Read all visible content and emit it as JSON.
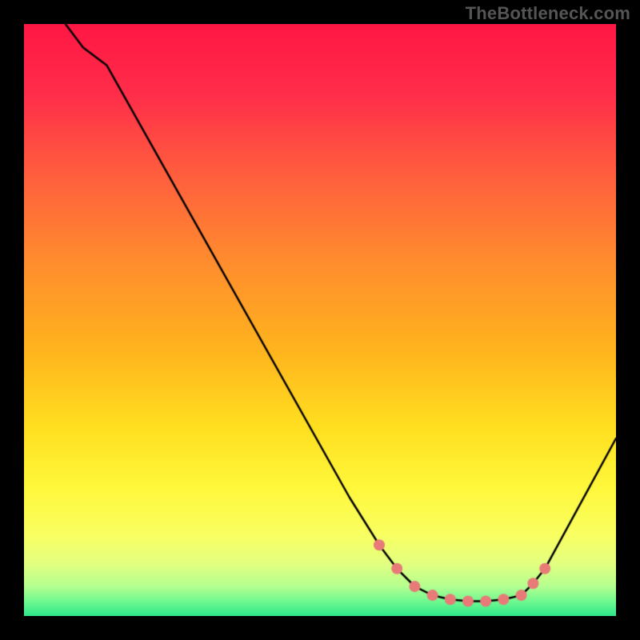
{
  "watermark": "TheBottleneck.com",
  "chart_data": {
    "type": "line",
    "title": "",
    "xlabel": "",
    "ylabel": "",
    "xlim": [
      0,
      100
    ],
    "ylim": [
      0,
      100
    ],
    "series": [
      {
        "name": "curve",
        "x": [
          7,
          10,
          14,
          55,
          60,
          63,
          66,
          69,
          72,
          75,
          78,
          81,
          84,
          86,
          88,
          100
        ],
        "y": [
          100,
          96,
          93,
          20,
          12,
          8,
          5,
          3.5,
          2.8,
          2.5,
          2.5,
          2.8,
          3.5,
          5.5,
          8,
          30
        ],
        "stroke": "#000000",
        "stroke_width": 2.5
      }
    ],
    "markers": {
      "name": "flat-points",
      "x": [
        60,
        63,
        66,
        69,
        72,
        75,
        78,
        81,
        84,
        86,
        88
      ],
      "y": [
        12,
        8,
        5,
        3.5,
        2.8,
        2.5,
        2.5,
        2.8,
        3.5,
        5.5,
        8
      ],
      "radius": 7,
      "fill": "#e87a78"
    },
    "background_gradient": {
      "stops": [
        {
          "offset": 0.0,
          "color": "#ff1744"
        },
        {
          "offset": 0.12,
          "color": "#ff2e4a"
        },
        {
          "offset": 0.25,
          "color": "#ff5d3e"
        },
        {
          "offset": 0.4,
          "color": "#ff8c2e"
        },
        {
          "offset": 0.55,
          "color": "#ffb41e"
        },
        {
          "offset": 0.68,
          "color": "#ffdf20"
        },
        {
          "offset": 0.78,
          "color": "#fff73a"
        },
        {
          "offset": 0.86,
          "color": "#faff60"
        },
        {
          "offset": 0.91,
          "color": "#e4ff80"
        },
        {
          "offset": 0.95,
          "color": "#b4ff90"
        },
        {
          "offset": 0.975,
          "color": "#70f990"
        },
        {
          "offset": 1.0,
          "color": "#2ee88a"
        }
      ]
    }
  }
}
